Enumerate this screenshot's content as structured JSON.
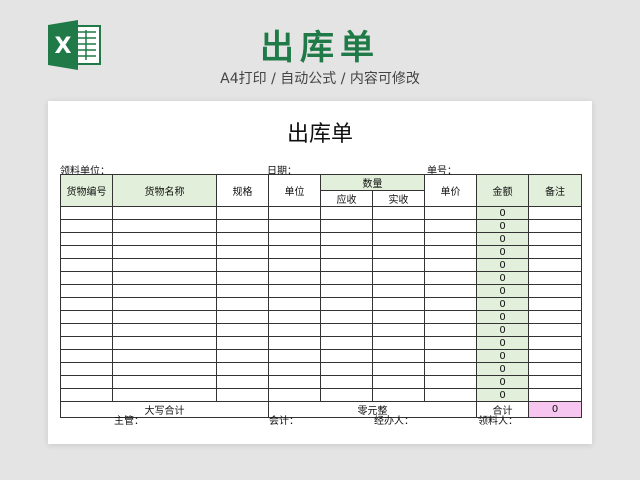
{
  "banner": {
    "icon_letter": "X",
    "title": "出库单",
    "subtitle": "A4打印 / 自动公式 / 内容可修改"
  },
  "sheet": {
    "title": "出库单",
    "meta": {
      "recipient_unit": "领料单位：",
      "date": "日期：",
      "doc_no": "单号："
    },
    "headers": {
      "code": "货物编号",
      "name": "货物名称",
      "spec": "规格",
      "unit": "单位",
      "quantity": "数量",
      "qty_due": "应收",
      "qty_actual": "实收",
      "price": "单价",
      "amount": "金额",
      "remark": "备注"
    },
    "rows": [
      {
        "amount": "0"
      },
      {
        "amount": "0"
      },
      {
        "amount": "0"
      },
      {
        "amount": "0"
      },
      {
        "amount": "0"
      },
      {
        "amount": "0"
      },
      {
        "amount": "0"
      },
      {
        "amount": "0"
      },
      {
        "amount": "0"
      },
      {
        "amount": "0"
      },
      {
        "amount": "0"
      },
      {
        "amount": "0"
      },
      {
        "amount": "0"
      },
      {
        "amount": "0"
      },
      {
        "amount": "0"
      }
    ],
    "total_row": {
      "capital_label": "大写合计",
      "capital_value": "零元整",
      "sum_label": "合计",
      "sum_value": "0"
    },
    "footer": {
      "supervisor": "主管：",
      "accountant": "会计：",
      "handler": "经办人：",
      "receiver": "领料人："
    }
  },
  "colors": {
    "brand_green": "#1f7a47",
    "header_fill": "#e2efda",
    "total_fill": "#f6c6f0"
  }
}
